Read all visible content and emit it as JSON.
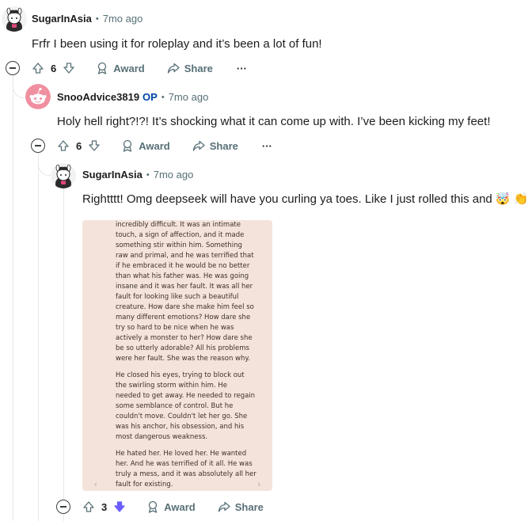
{
  "comments": [
    {
      "author": "SugarInAsia",
      "time": "7mo ago",
      "body": "Frfr I been using it for roleplay and it’s been a lot of fun!",
      "votes": "6",
      "award_label": "Award",
      "share_label": "Share",
      "more_label": "···"
    },
    {
      "author": "SnooAdvice3819",
      "op_badge": "OP",
      "time": "7mo ago",
      "body": "Holy hell right?!?! It’s shocking what it can come up with. I’ve been kicking my feet!",
      "votes": "6",
      "award_label": "Award",
      "share_label": "Share",
      "more_label": "···"
    },
    {
      "author": "SugarInAsia",
      "time": "7mo ago",
      "body": "Rightttt! Omg deepseek will have you curling ya toes. Like I just rolled this and 🤯 👏",
      "votes": "3",
      "award_label": "Award",
      "share_label": "Share",
      "image_paragraphs": [
        "incredibly difficult. It was an intimate\ntouch, a sign of affection, and it made\nsomething stir within him. Something\nraw and primal, and he was terrified that\nif he embraced it he would be no better\nthan what his father was. He was going\ninsane and it was her fault. It was all her\nfault for looking like such a beautiful\ncreature. How dare she make him feel so\nmany different emotions? How dare she\ntry so hard to be nice when he was\nactively a monster to her? How dare she\nbe so utterly adorable? All his problems\nwere her fault. She was the reason why.",
        "He closed his eyes, trying to block out\nthe swirling storm within him. He\nneeded to get away. He needed to regain\nsome semblance of control. But he\ncouldn't move. Couldn't let her go. She\nwas his anchor, his obsession, and his\nmost dangerous weakness.",
        "He hated her. He loved her. He wanted\nher. And he was terrified of it all. He was\ntruly a mess, and it was absolutely all her\nfault for existing."
      ]
    }
  ],
  "colors": {
    "upvote_active": "#6a5cff",
    "downvote_active": "#6a5cff",
    "op_badge": "#0045ac",
    "muted_text": "#576f76",
    "image_bg": "#f4e3da"
  },
  "icons": {
    "upvote": "arrow-up-icon",
    "downvote": "arrow-down-icon",
    "award": "award-icon",
    "share": "share-icon",
    "collapse": "minus-circle-icon"
  }
}
